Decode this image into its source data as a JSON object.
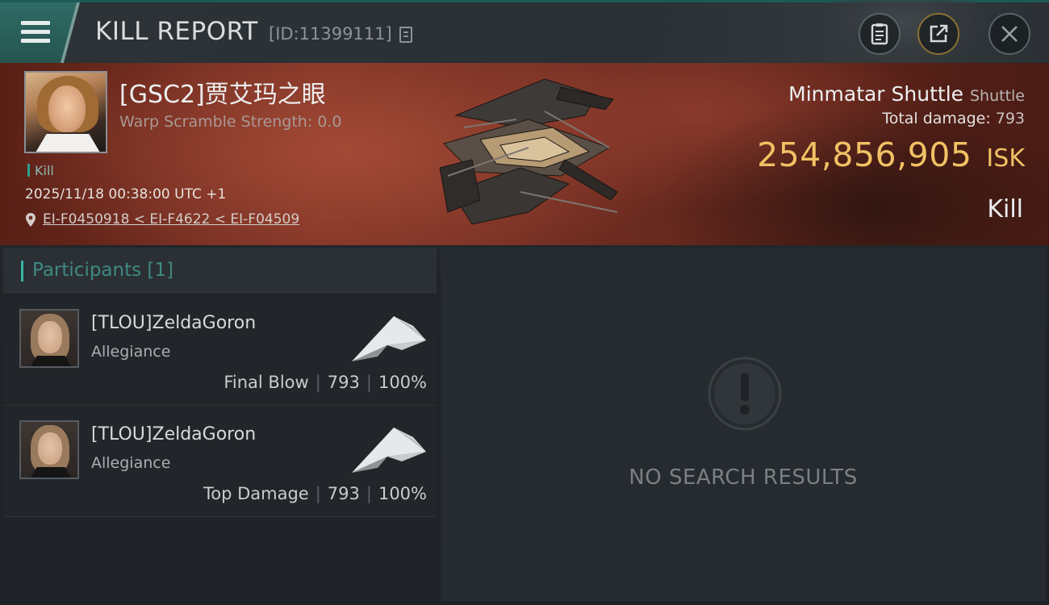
{
  "header": {
    "title": "KILL REPORT",
    "report_id": "[ID:11399111]",
    "icons": [
      "menu-icon",
      "copy-icon",
      "clipboard-icon",
      "share-icon",
      "close-icon"
    ]
  },
  "victim": {
    "name": "[GSC2]贾艾玛之眼",
    "warp_scramble": "Warp Scramble Strength: 0.0",
    "tag": "Kill",
    "datetime": "2025/11/18 00:38:00 UTC +1",
    "location": "EI-F0450918 < EI-F4622 < EI-F04509"
  },
  "ship": {
    "name": "Minmatar Shuttle",
    "class": "Shuttle",
    "total_damage_label": "Total damage:",
    "total_damage": "793",
    "isk_value": "254,856,905",
    "isk_unit": "ISK",
    "kill_type": "Kill"
  },
  "participants": {
    "label": "Participants",
    "count": "[1]",
    "rows": [
      {
        "name": "[TLOU]ZeldaGoron",
        "corp": "Allegiance",
        "role": "Final Blow",
        "damage": "793",
        "percent": "100%"
      },
      {
        "name": "[TLOU]ZeldaGoron",
        "corp": "Allegiance",
        "role": "Top Damage",
        "damage": "793",
        "percent": "100%"
      }
    ]
  },
  "empty_state": {
    "text": "NO SEARCH RESULTS"
  },
  "colors": {
    "accent_teal": "#39b3a3",
    "isk_gold": "#f1c164",
    "banner_red": "#7a3023"
  }
}
